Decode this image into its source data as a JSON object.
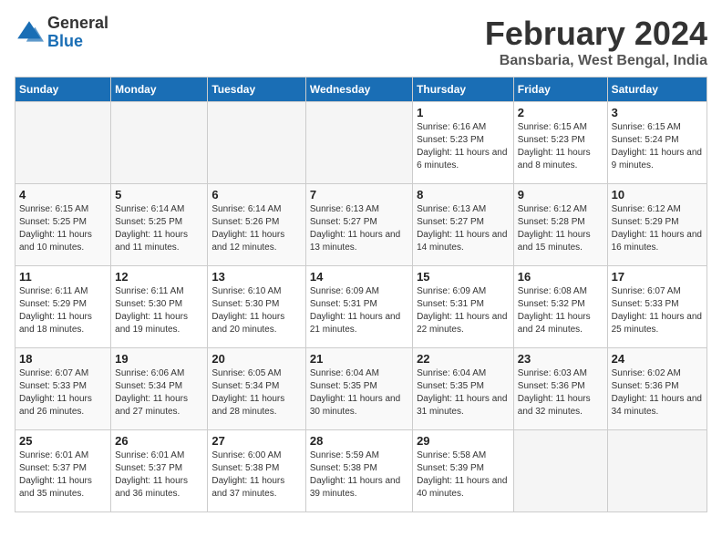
{
  "logo": {
    "text_general": "General",
    "text_blue": "Blue"
  },
  "title": "February 2024",
  "subtitle": "Bansbaria, West Bengal, India",
  "days_of_week": [
    "Sunday",
    "Monday",
    "Tuesday",
    "Wednesday",
    "Thursday",
    "Friday",
    "Saturday"
  ],
  "weeks": [
    [
      {
        "day": "",
        "info": ""
      },
      {
        "day": "",
        "info": ""
      },
      {
        "day": "",
        "info": ""
      },
      {
        "day": "",
        "info": ""
      },
      {
        "day": "1",
        "info": "Sunrise: 6:16 AM\nSunset: 5:23 PM\nDaylight: 11 hours and 6 minutes."
      },
      {
        "day": "2",
        "info": "Sunrise: 6:15 AM\nSunset: 5:23 PM\nDaylight: 11 hours and 8 minutes."
      },
      {
        "day": "3",
        "info": "Sunrise: 6:15 AM\nSunset: 5:24 PM\nDaylight: 11 hours and 9 minutes."
      }
    ],
    [
      {
        "day": "4",
        "info": "Sunrise: 6:15 AM\nSunset: 5:25 PM\nDaylight: 11 hours and 10 minutes."
      },
      {
        "day": "5",
        "info": "Sunrise: 6:14 AM\nSunset: 5:25 PM\nDaylight: 11 hours and 11 minutes."
      },
      {
        "day": "6",
        "info": "Sunrise: 6:14 AM\nSunset: 5:26 PM\nDaylight: 11 hours and 12 minutes."
      },
      {
        "day": "7",
        "info": "Sunrise: 6:13 AM\nSunset: 5:27 PM\nDaylight: 11 hours and 13 minutes."
      },
      {
        "day": "8",
        "info": "Sunrise: 6:13 AM\nSunset: 5:27 PM\nDaylight: 11 hours and 14 minutes."
      },
      {
        "day": "9",
        "info": "Sunrise: 6:12 AM\nSunset: 5:28 PM\nDaylight: 11 hours and 15 minutes."
      },
      {
        "day": "10",
        "info": "Sunrise: 6:12 AM\nSunset: 5:29 PM\nDaylight: 11 hours and 16 minutes."
      }
    ],
    [
      {
        "day": "11",
        "info": "Sunrise: 6:11 AM\nSunset: 5:29 PM\nDaylight: 11 hours and 18 minutes."
      },
      {
        "day": "12",
        "info": "Sunrise: 6:11 AM\nSunset: 5:30 PM\nDaylight: 11 hours and 19 minutes."
      },
      {
        "day": "13",
        "info": "Sunrise: 6:10 AM\nSunset: 5:30 PM\nDaylight: 11 hours and 20 minutes."
      },
      {
        "day": "14",
        "info": "Sunrise: 6:09 AM\nSunset: 5:31 PM\nDaylight: 11 hours and 21 minutes."
      },
      {
        "day": "15",
        "info": "Sunrise: 6:09 AM\nSunset: 5:31 PM\nDaylight: 11 hours and 22 minutes."
      },
      {
        "day": "16",
        "info": "Sunrise: 6:08 AM\nSunset: 5:32 PM\nDaylight: 11 hours and 24 minutes."
      },
      {
        "day": "17",
        "info": "Sunrise: 6:07 AM\nSunset: 5:33 PM\nDaylight: 11 hours and 25 minutes."
      }
    ],
    [
      {
        "day": "18",
        "info": "Sunrise: 6:07 AM\nSunset: 5:33 PM\nDaylight: 11 hours and 26 minutes."
      },
      {
        "day": "19",
        "info": "Sunrise: 6:06 AM\nSunset: 5:34 PM\nDaylight: 11 hours and 27 minutes."
      },
      {
        "day": "20",
        "info": "Sunrise: 6:05 AM\nSunset: 5:34 PM\nDaylight: 11 hours and 28 minutes."
      },
      {
        "day": "21",
        "info": "Sunrise: 6:04 AM\nSunset: 5:35 PM\nDaylight: 11 hours and 30 minutes."
      },
      {
        "day": "22",
        "info": "Sunrise: 6:04 AM\nSunset: 5:35 PM\nDaylight: 11 hours and 31 minutes."
      },
      {
        "day": "23",
        "info": "Sunrise: 6:03 AM\nSunset: 5:36 PM\nDaylight: 11 hours and 32 minutes."
      },
      {
        "day": "24",
        "info": "Sunrise: 6:02 AM\nSunset: 5:36 PM\nDaylight: 11 hours and 34 minutes."
      }
    ],
    [
      {
        "day": "25",
        "info": "Sunrise: 6:01 AM\nSunset: 5:37 PM\nDaylight: 11 hours and 35 minutes."
      },
      {
        "day": "26",
        "info": "Sunrise: 6:01 AM\nSunset: 5:37 PM\nDaylight: 11 hours and 36 minutes."
      },
      {
        "day": "27",
        "info": "Sunrise: 6:00 AM\nSunset: 5:38 PM\nDaylight: 11 hours and 37 minutes."
      },
      {
        "day": "28",
        "info": "Sunrise: 5:59 AM\nSunset: 5:38 PM\nDaylight: 11 hours and 39 minutes."
      },
      {
        "day": "29",
        "info": "Sunrise: 5:58 AM\nSunset: 5:39 PM\nDaylight: 11 hours and 40 minutes."
      },
      {
        "day": "",
        "info": ""
      },
      {
        "day": "",
        "info": ""
      }
    ]
  ]
}
